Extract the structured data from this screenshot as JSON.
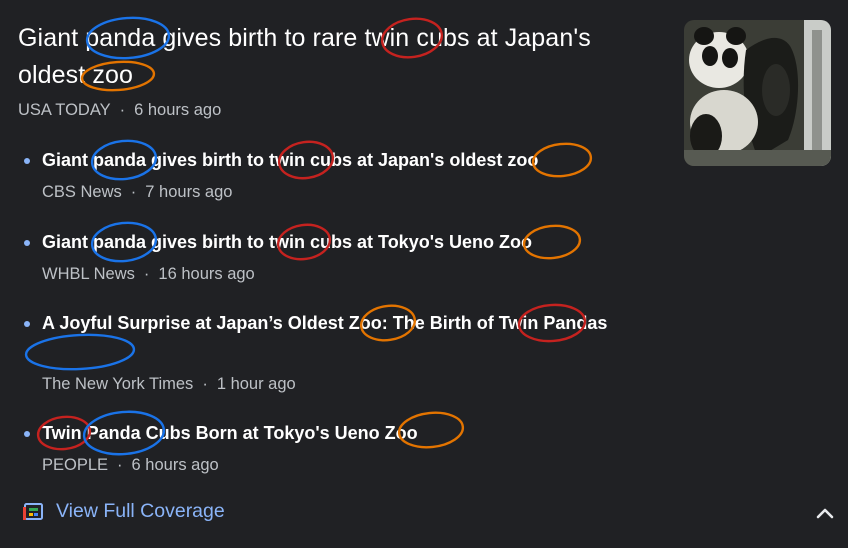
{
  "main_story": {
    "title": "Giant panda gives birth to rare twin cubs at Japan's oldest zoo",
    "source": "USA TODAY",
    "time": "6 hours ago"
  },
  "thumbnail": {
    "icon": "panda-photo",
    "description": ""
  },
  "related": [
    {
      "title": "Giant panda gives birth to twin cubs at Japan's oldest zoo",
      "source": "CBS News",
      "time": "7 hours ago"
    },
    {
      "title": "Giant panda gives birth to twin cubs at Tokyo's Ueno Zoo",
      "source": "WHBL News",
      "time": "16 hours ago"
    },
    {
      "title": "A Joyful Surprise at Japan’s Oldest Zoo: The Birth of Twin Pandas",
      "source": "The New York Times",
      "time": "1 hour ago"
    },
    {
      "title": "Twin Panda Cubs Born at Tokyo's Ueno Zoo",
      "source": "PEOPLE",
      "time": "6 hours ago"
    }
  ],
  "footer": {
    "full_coverage_label": "View Full Coverage",
    "full_coverage_icon": "newspaper-icon",
    "collapse_icon": "chevron-up-icon"
  },
  "colors": {
    "background": "#202124",
    "link": "#8ab4f8",
    "annotation_panda": "#1a73e8",
    "annotation_twin": "#c5221f",
    "annotation_zoo": "#e37400"
  }
}
